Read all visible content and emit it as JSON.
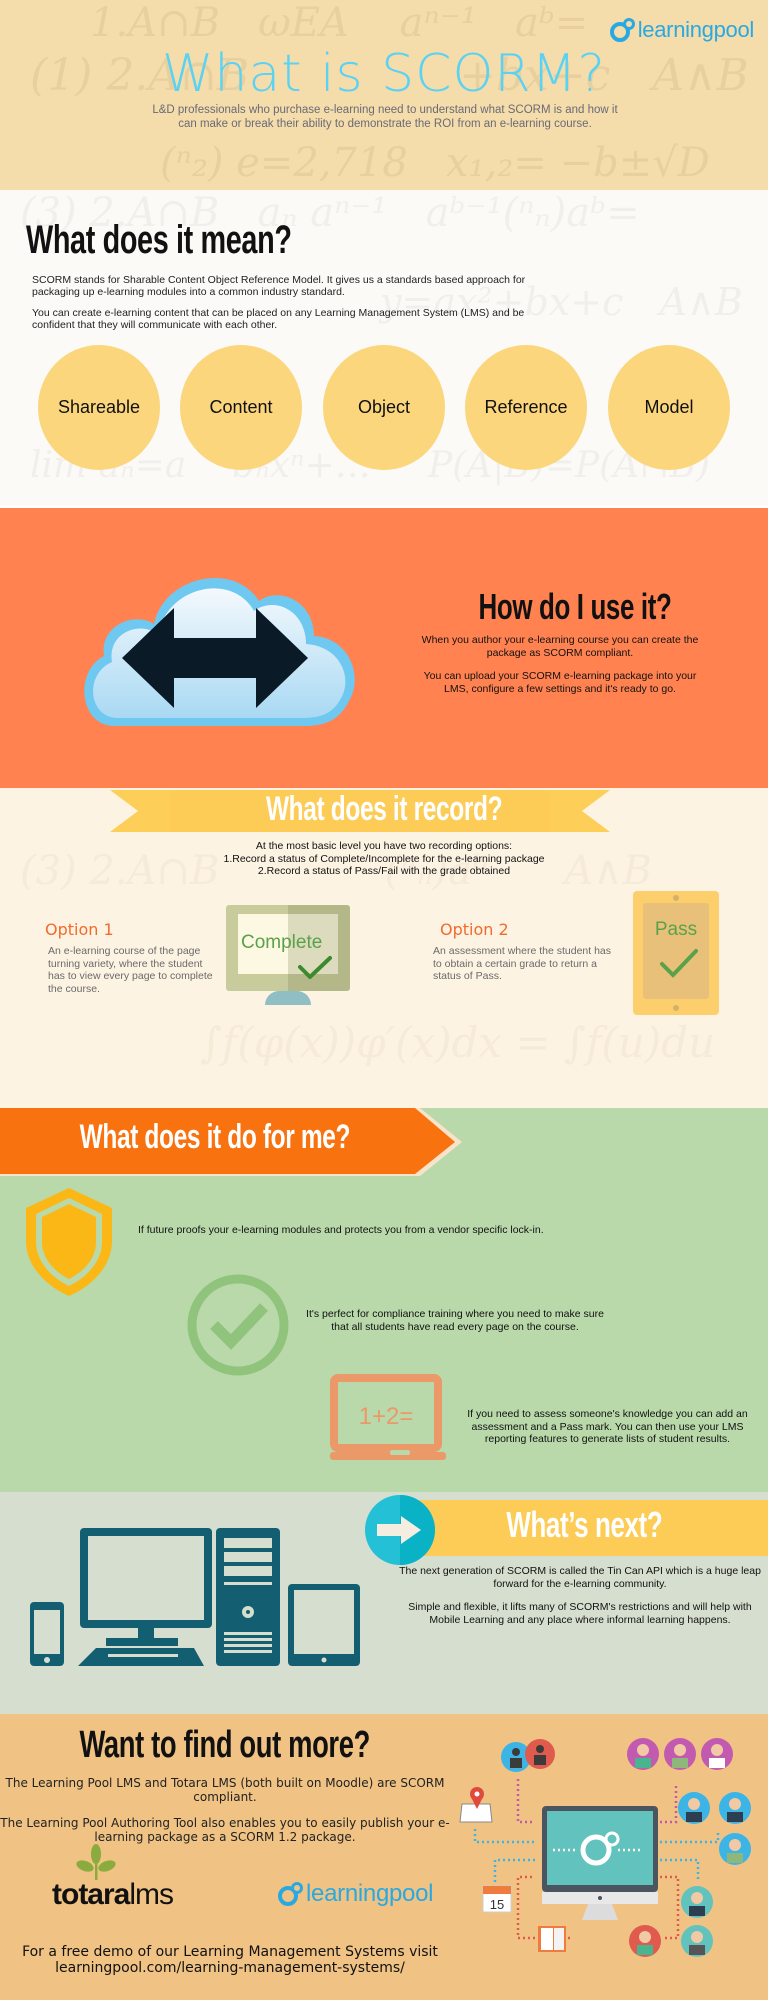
{
  "header": {
    "logo_text": "learningpool",
    "title": "What is SCORM?",
    "subtitle": "L&D professionals who purchase e-learning need to understand what SCORM is and how it can make or break their ability to demonstrate the ROI from an e-learning course."
  },
  "meaning": {
    "title": "What does it mean?",
    "paragraphs": [
      "SCORM stands for Sharable Content Object Reference Model. It gives us a standards based approach for packaging up e-learning modules into a common industry standard.",
      "You can create e-learning content that can be placed on any Learning Management System (LMS) and be confident that they will communicate with each other."
    ],
    "words": [
      "Shareable",
      "Content",
      "Object",
      "Reference",
      "Model"
    ]
  },
  "how": {
    "title": "How do I use it?",
    "paragraphs": [
      "When you author your e-learning course you can create the package as SCORM compliant.",
      "You can upload your SCORM e-learning package into your LMS, configure a few settings and it's ready to go."
    ]
  },
  "record": {
    "title": "What does it record?",
    "intro": [
      "At the most basic level you have two recording options:",
      "1.Record a status of Complete/Incomplete for the e-learning package",
      "2.Record a status of Pass/Fail with the grade obtained"
    ],
    "options": [
      {
        "title": "Option 1",
        "text": "An e-learning course of the page turning variety, where the student has to view every page to complete the course.",
        "badge": "Complete"
      },
      {
        "title": "Option 2",
        "text": "An assessment where the student has to obtain a certain grade to return a status of Pass.",
        "badge": "Pass"
      }
    ]
  },
  "benefits": {
    "title": "What does it do for me?",
    "items": [
      {
        "icon": "shield-icon",
        "text": "If future proofs your e-learning modules and protects you from a vendor specific lock-in."
      },
      {
        "icon": "check-circle-icon",
        "text": "It's perfect for compliance training where you need to make sure that all students have read every page on the course."
      },
      {
        "icon": "laptop-icon",
        "icon_text": "1+2=",
        "text": "If you need to assess someone's knowledge you can add an assessment and a Pass mark. You can then use your LMS reporting features to generate lists of student results."
      }
    ]
  },
  "next": {
    "title": "What’s next?",
    "paragraphs": [
      "The next generation of SCORM is called the Tin Can API which is a huge leap forward for the e-learning community.",
      "Simple and flexible, it lifts many of SCORM's restrictions and will help with Mobile Learning and any place where informal learning happens."
    ]
  },
  "more": {
    "title": "Want to find out more?",
    "paragraphs": [
      "The Learning Pool LMS and Totara LMS (both built on Moodle) are SCORM compliant.",
      "The Learning Pool Authoring Tool also enables you to easily publish your e-learning package as a SCORM 1.2 package."
    ],
    "totara_bold": "totara",
    "totara_light": "lms",
    "logo_text": "learningpool",
    "demo_line1": "For a free demo of our Learning Management Systems visit",
    "demo_line2": "learningpool.com/learning-management-systems/",
    "calendar_day": "15"
  },
  "colors": {
    "brand_blue": "#29a9e1",
    "title_cyan": "#5ad2f4",
    "orange": "#ff8250",
    "banner_orange": "#f8720f",
    "yellow": "#fdcc56",
    "circle_yellow": "#fbd67c",
    "green_bg": "#b9d9ab",
    "teal": "#135e70"
  }
}
